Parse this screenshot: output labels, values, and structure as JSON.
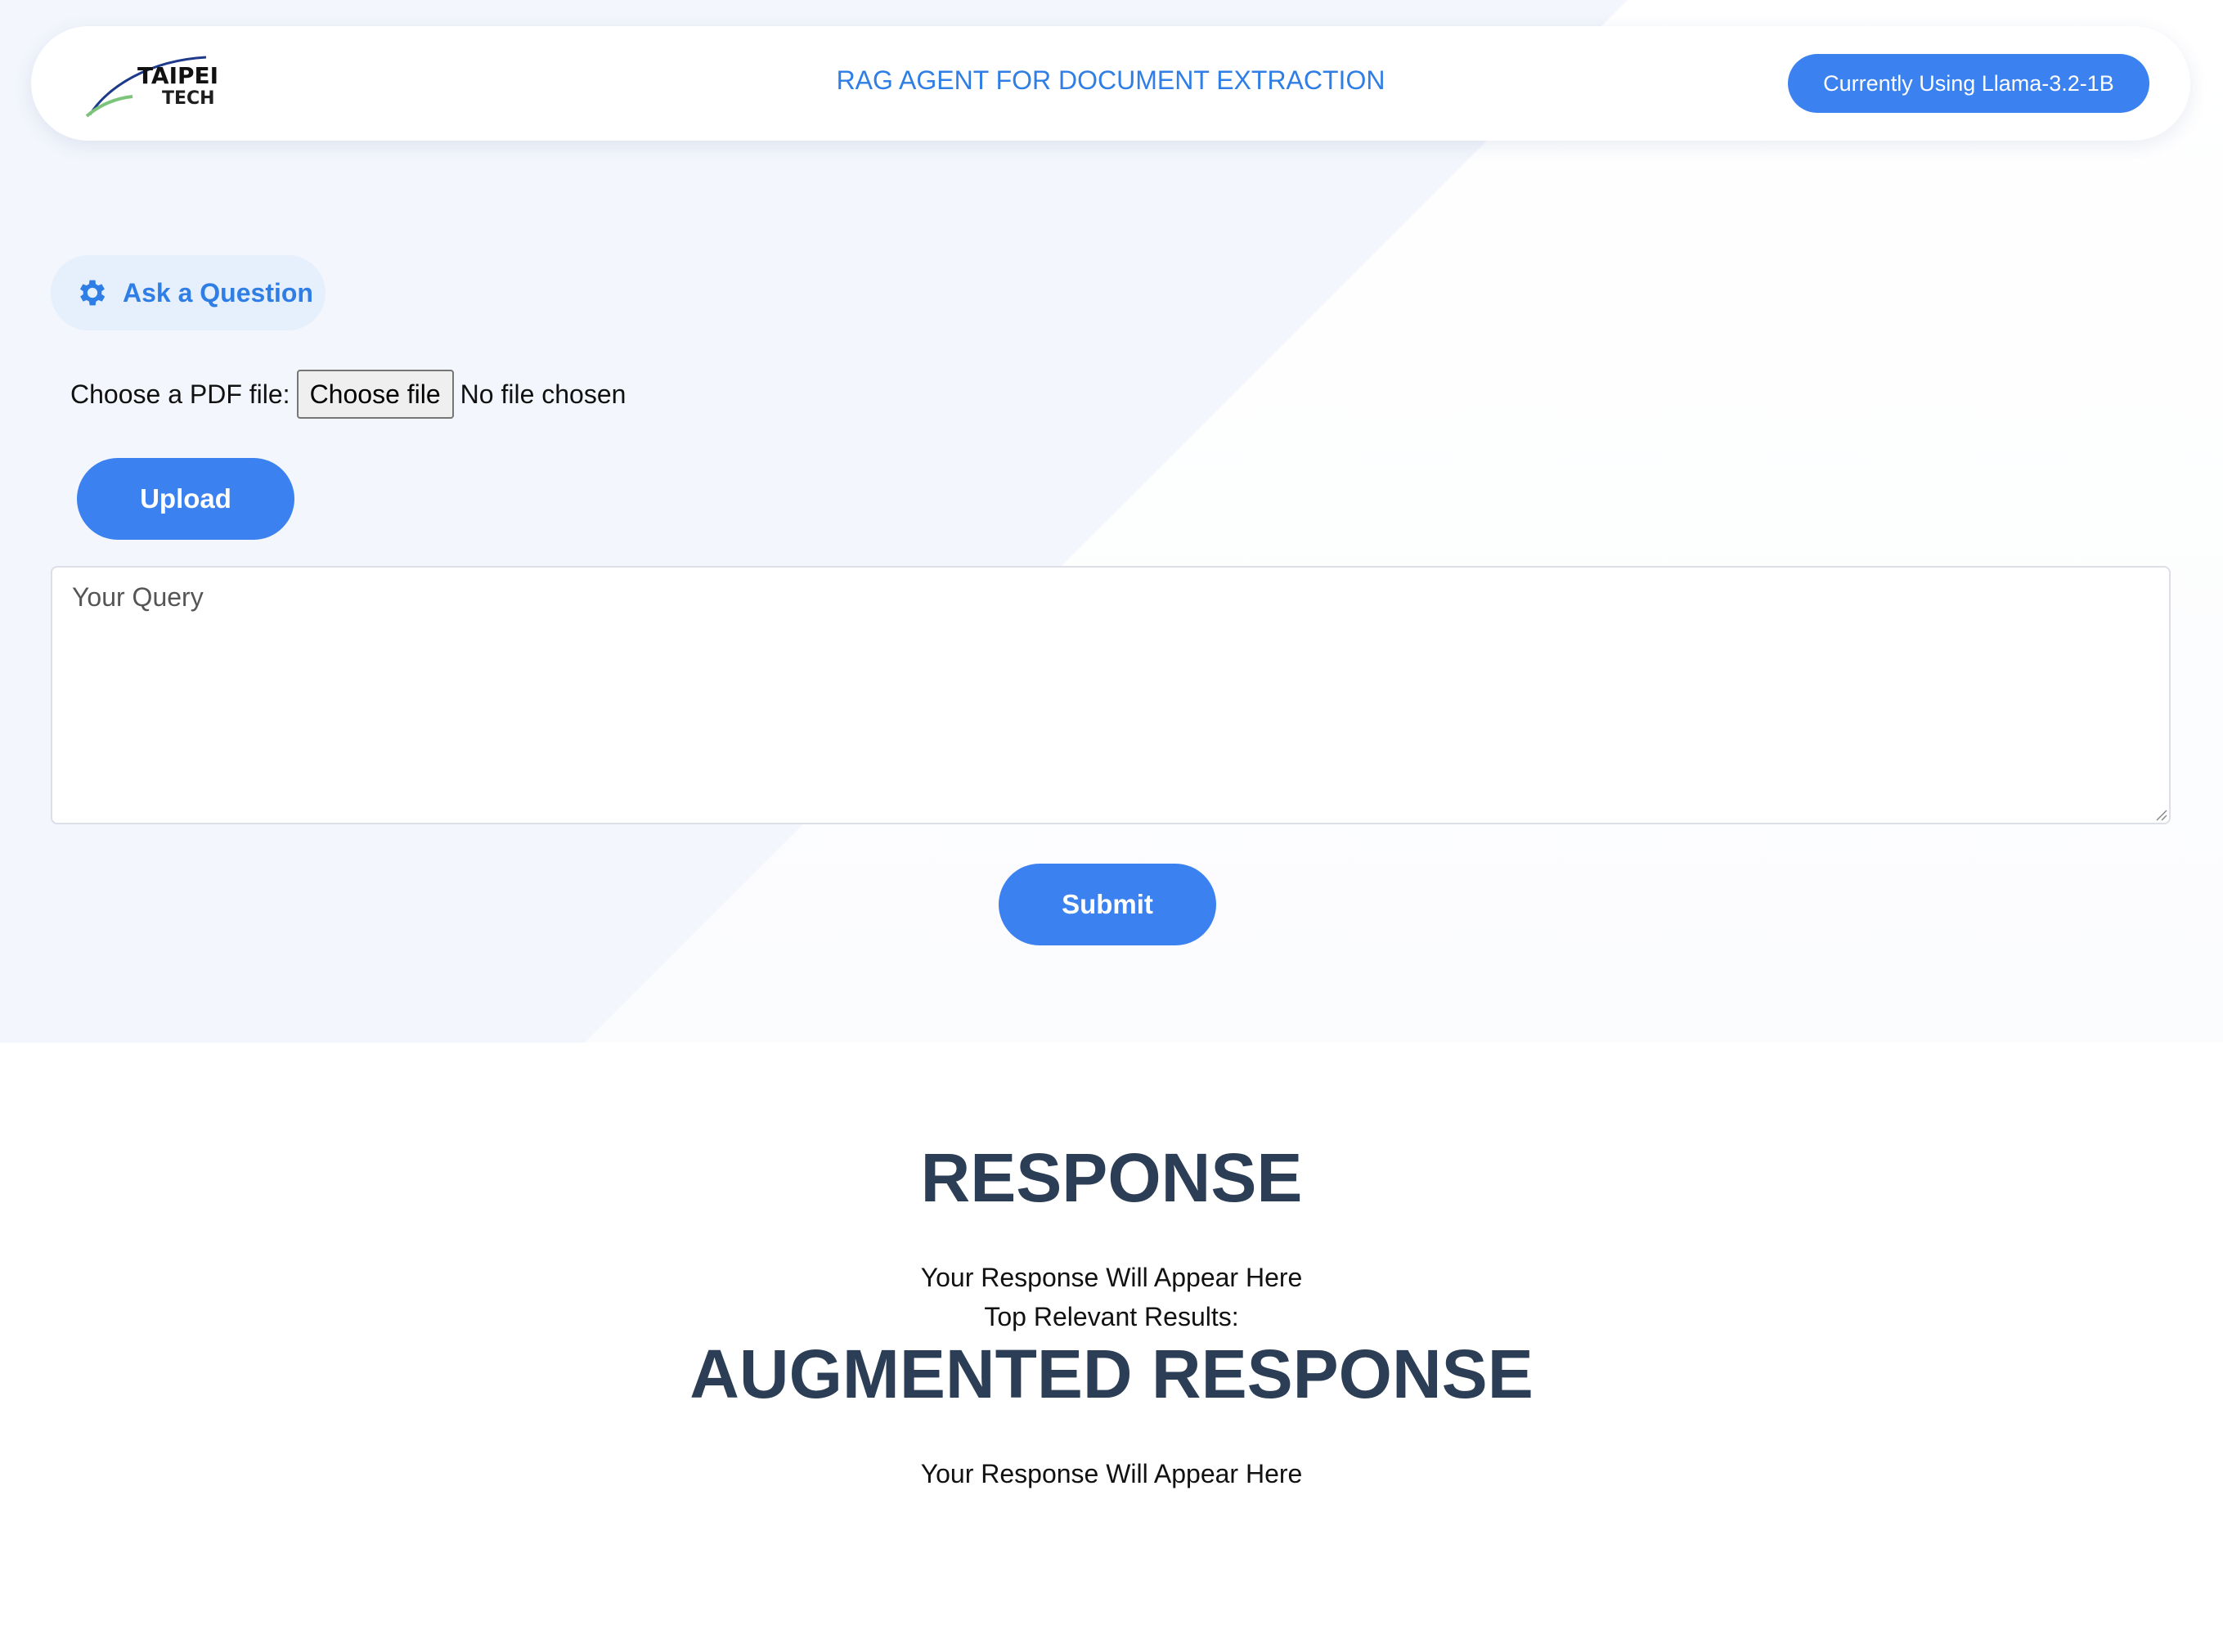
{
  "header": {
    "logo": {
      "line1": "TAIPEI",
      "line2": "TECH"
    },
    "title": "RAG AGENT FOR DOCUMENT EXTRACTION",
    "model_button": "Currently Using Llama-3.2-1B"
  },
  "ask": {
    "label": "Ask a Question",
    "icon": "gear-icon"
  },
  "file": {
    "label": "Choose a PDF file:",
    "button": "Choose file",
    "status": "No file chosen"
  },
  "upload_button": "Upload",
  "query": {
    "placeholder": "Your Query",
    "value": ""
  },
  "submit_button": "Submit",
  "response": {
    "heading": "RESPONSE",
    "text": "Your Response Will Appear Here",
    "top_results_label": "Top Relevant Results:"
  },
  "augmented": {
    "heading": "AUGMENTED RESPONSE",
    "text": "Your Response Will Appear Here"
  },
  "colors": {
    "accent": "#3b82f0",
    "title_blue": "#2f7ee6",
    "heading_dark": "#2c3e55",
    "chip_bg": "#e6effc"
  }
}
